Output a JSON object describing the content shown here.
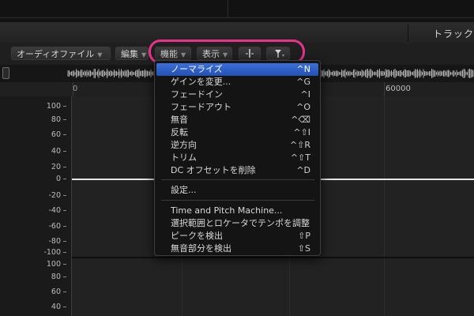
{
  "window": {
    "title": "トラック"
  },
  "toolbar": {
    "audio_file": "オーディオファイル",
    "edit": "編集",
    "functions": "機能",
    "view": "表示"
  },
  "ruler": {
    "marker_60000": "60000",
    "marker_zero": "0"
  },
  "amplitude_axis": {
    "upper_channel": [
      "100",
      "80",
      "60",
      "40",
      "20",
      "0",
      "-20",
      "-40",
      "-60",
      "-80",
      "-100"
    ],
    "lower_channel": [
      "100",
      "80",
      "60",
      "40",
      "20"
    ]
  },
  "functions_menu": {
    "items": [
      {
        "label": "ノーマライズ",
        "shortcut": "^N",
        "selected": true
      },
      {
        "label": "ゲインを変更...",
        "shortcut": "^G"
      },
      {
        "label": "フェードイン",
        "shortcut": "^I"
      },
      {
        "label": "フェードアウト",
        "shortcut": "^O"
      },
      {
        "label": "無音",
        "shortcut": "^⌫"
      },
      {
        "label": "反転",
        "shortcut": "^⇧I"
      },
      {
        "label": "逆方向",
        "shortcut": "^⇧R"
      },
      {
        "label": "トリム",
        "shortcut": "^⇧T"
      },
      {
        "label": "DC オフセットを削除",
        "shortcut": "^D"
      },
      {
        "label": "設定...",
        "shortcut": ""
      },
      {
        "label": "Time and Pitch Machine...",
        "shortcut": ""
      },
      {
        "label": "選択範囲とロケータでテンポを調整",
        "shortcut": ""
      },
      {
        "label": "ピークを検出",
        "shortcut": "⇧P"
      },
      {
        "label": "無音部分を検出",
        "shortcut": "⇧S"
      }
    ]
  },
  "colors": {
    "highlight_ring": "#e8338a",
    "menu_selection": "#2f5fc8",
    "zero_line": "#e6e6e6"
  },
  "icons": [
    "chevron-down-icon",
    "snap-icon",
    "catch-playhead-icon"
  ]
}
